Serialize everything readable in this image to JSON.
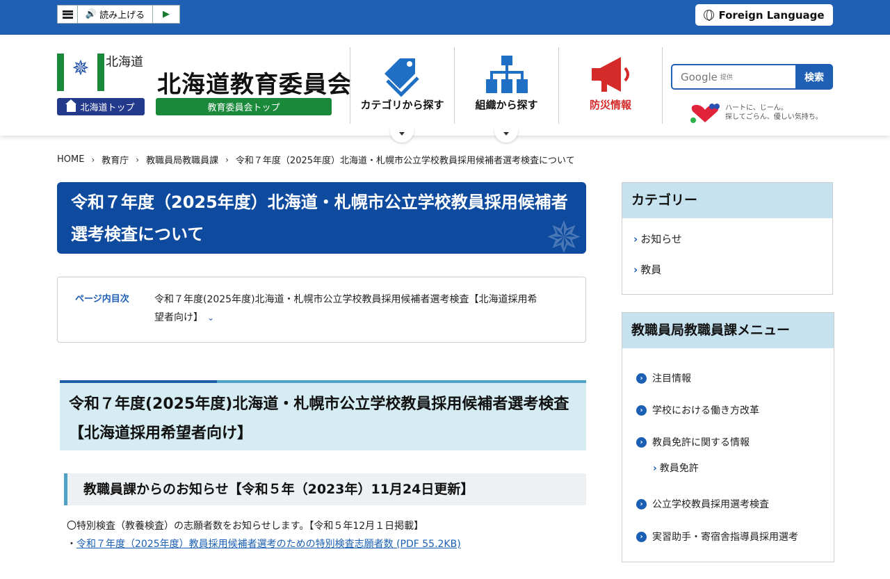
{
  "topbar": {
    "read_aloud_label": "読み上げる",
    "foreign_language_label": "Foreign Language"
  },
  "header": {
    "prefecture_name": "北海道",
    "hokkaido_top_label": "北海道トップ",
    "board_name": "北海道教育委員会",
    "board_top_label": "教育委員会トップ",
    "nav": [
      {
        "label": "カテゴリから探す"
      },
      {
        "label": "組織から探す"
      },
      {
        "label": "防災情報"
      }
    ],
    "search": {
      "placeholder_brand": "Google",
      "placeholder_sub": "提供",
      "button_label": "検索"
    },
    "heart_banner": {
      "line1": "ハートに、じーん。",
      "line2": "探してごらん、優しい気持ち。"
    }
  },
  "breadcrumb": [
    "HOME",
    "教育庁",
    "教職員局教職員課",
    "令和７年度（2025年度）北海道・札幌市公立学校教員採用候補者選考検査について"
  ],
  "main": {
    "page_title": "令和７年度（2025年度）北海道・札幌市公立学校教員採用候補者選考検査について",
    "toc": {
      "label": "ページ内目次",
      "item": "令和７年度(2025年度)北海道・札幌市公立学校教員採用候補者選考検査【北海道採用希望者向け】"
    },
    "h2": "令和７年度(2025年度)北海道・札幌市公立学校教員採用候補者選考検査【北海道採用希望者向け】",
    "h3": "教職員課からのお知らせ【令和５年（2023年）11月24日更新】",
    "notice": "〇特別検査（教養検査）の志願者数をお知らせします。【令和５年12月１日掲載】",
    "notice_link_prefix": "・",
    "notice_link": "令和７年度（2025年度）教員採用候補者選考のための特別検査志願者数 (PDF 55.2KB)"
  },
  "sidebar": {
    "category_title": "カテゴリー",
    "categories": [
      "お知らせ",
      "教員"
    ],
    "menu_title": "教職員局教職員課メニュー",
    "menu": [
      "注目情報",
      "学校における働き方改革",
      "教員免許に関する情報",
      "公立学校教員採用選考検査",
      "実習助手・寄宿舎指導員採用選考"
    ],
    "menu_sub": "教員免許"
  },
  "colors": {
    "brand_blue": "#1f5fb4",
    "title_blue": "#0e4b9e",
    "brand_green": "#1a8a3a",
    "disaster_red": "#d42a2a"
  }
}
